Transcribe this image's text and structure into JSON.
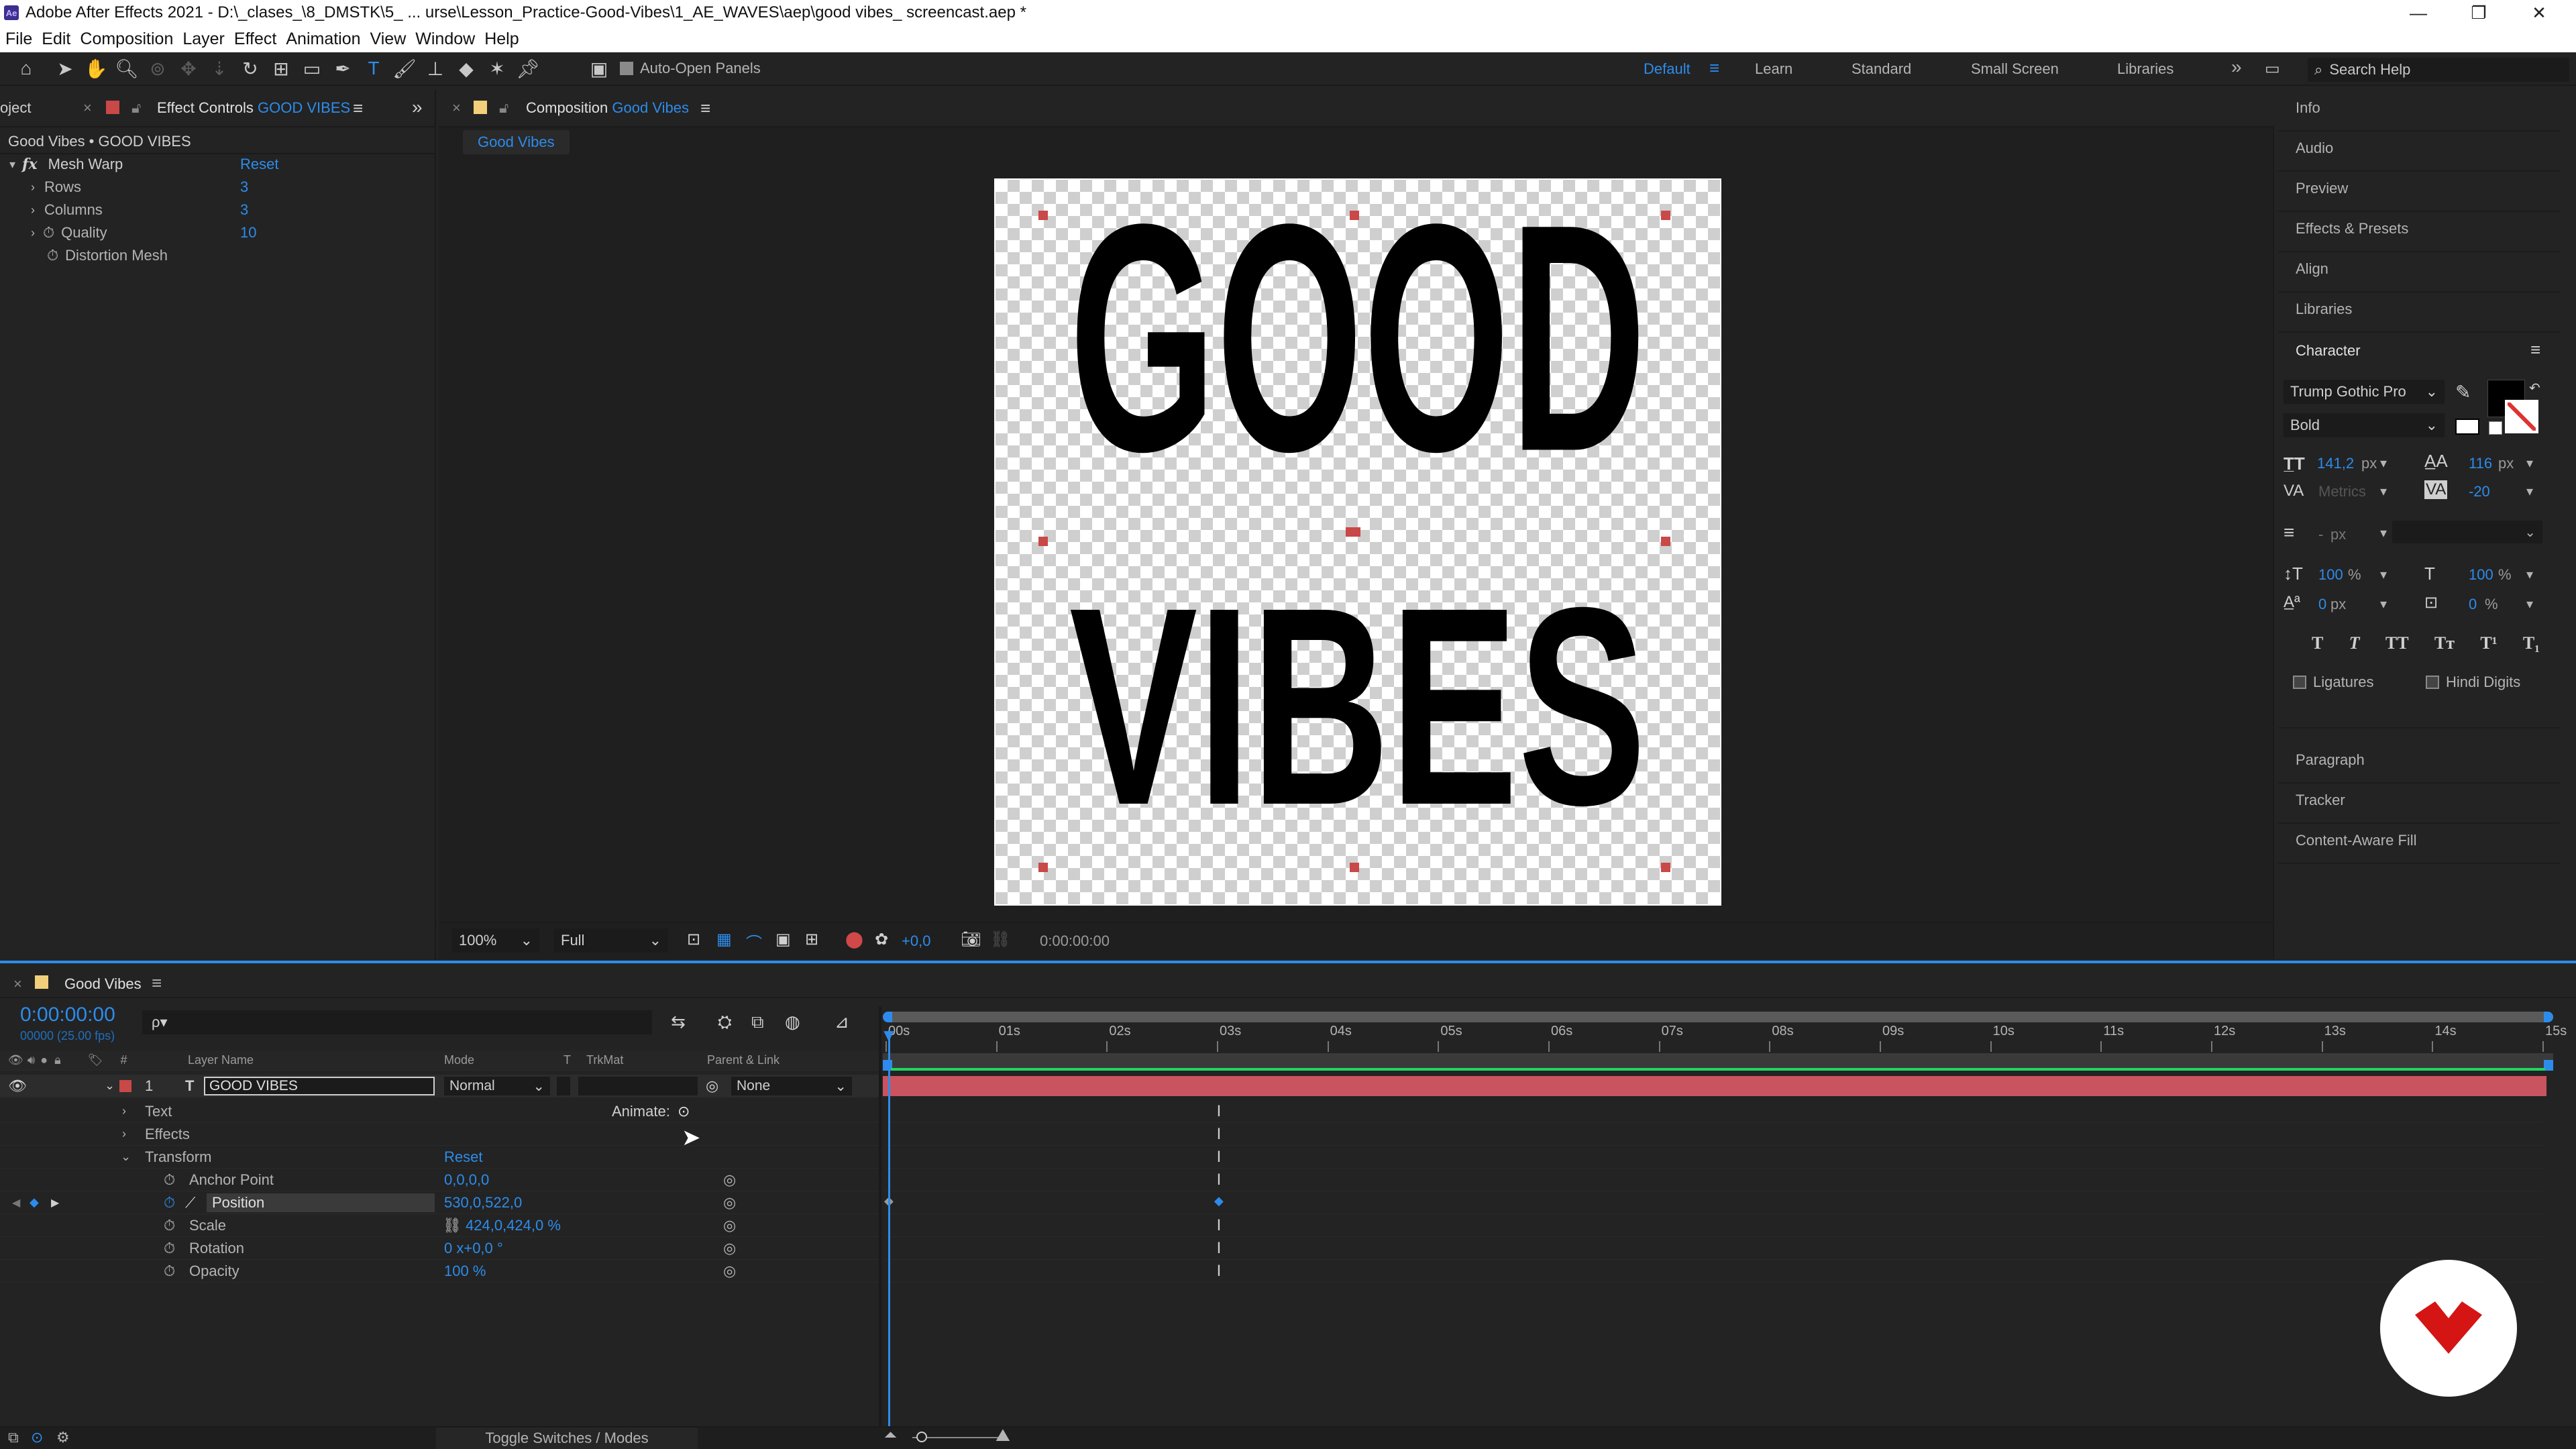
{
  "window": {
    "title": "Adobe After Effects 2021 - D:\\_clases_\\8_DMSTK\\5_ ... urse\\Lesson_Practice-Good-Vibes\\1_AE_WAVES\\aep\\good vibes_ screencast.aep *",
    "app_icon": "Ae",
    "minimize": "—",
    "maximize": "❐",
    "close": "✕"
  },
  "menu": [
    "File",
    "Edit",
    "Composition",
    "Layer",
    "Effect",
    "Animation",
    "View",
    "Window",
    "Help"
  ],
  "toolbar": {
    "auto_open_panels": "Auto-Open Panels",
    "workspaces": [
      "Default",
      "Learn",
      "Standard",
      "Small Screen",
      "Libraries"
    ],
    "active_workspace": "Default",
    "more": "»",
    "search_placeholder": "Search Help"
  },
  "effect_controls": {
    "left_tab": "oject",
    "tab_label": "Effect Controls",
    "tab_layer": "GOOD VIBES",
    "breadcrumb": "Good Vibes • GOOD VIBES",
    "effect_name": "Mesh Warp",
    "reset": "Reset",
    "props": [
      {
        "name": "Rows",
        "value": "3"
      },
      {
        "name": "Columns",
        "value": "3"
      },
      {
        "name": "Quality",
        "value": "10"
      },
      {
        "name": "Distortion Mesh",
        "value": ""
      }
    ]
  },
  "composition": {
    "tab_label": "Composition",
    "tab_name": "Good Vibes",
    "subtab": "Good Vibes",
    "artwork_line1": "GOOD",
    "artwork_line2": "VIBES",
    "zoom": "100%",
    "resolution": "Full",
    "exposure": "+0,0",
    "timecode": "0:00:00:00"
  },
  "side_panels": {
    "items_top": [
      "Info",
      "Audio",
      "Preview",
      "Effects & Presets",
      "Align",
      "Libraries"
    ],
    "character_title": "Character",
    "font_family": "Trump Gothic Pro",
    "font_style": "Bold",
    "font_size": "141,2",
    "font_size_unit": "px",
    "leading": "116",
    "leading_unit": "px",
    "kerning": "Metrics",
    "tracking": "-20",
    "stroke_width": "-",
    "stroke_unit": "px",
    "vert_scale": "100",
    "horiz_scale": "100",
    "pct": "%",
    "baseline": "0",
    "baseline_unit": "px",
    "tsume": "0",
    "styles": [
      "T",
      "T",
      "TT",
      "Tт",
      "T¹",
      "T₁"
    ],
    "ligatures": "Ligatures",
    "hindi_digits": "Hindi Digits",
    "items_bottom": [
      "Paragraph",
      "Tracker",
      "Content-Aware Fill"
    ]
  },
  "timeline": {
    "tab": "Good Vibes",
    "timecode": "0:00:00:00",
    "frame_info": "00000 (25.00 fps)",
    "search_placeholder": "ρ▾",
    "columns": {
      "layer_name": "Layer Name",
      "mode": "Mode",
      "t": "T",
      "trkmat": "TrkMat",
      "parent": "Parent & Link"
    },
    "layer": {
      "index": "1",
      "type": "T",
      "name": "GOOD VIBES",
      "mode": "Normal",
      "parent": "None"
    },
    "animate": "Animate:",
    "groups": [
      "Text",
      "Effects",
      "Transform"
    ],
    "transform_reset": "Reset",
    "transform_props": [
      {
        "name": "Anchor Point",
        "value": "0,0,0,0"
      },
      {
        "name": "Position",
        "value": "530,0,522,0"
      },
      {
        "name": "Scale",
        "value": "424,0,424,0 %"
      },
      {
        "name": "Rotation",
        "value": "0 x+0,0 °"
      },
      {
        "name": "Opacity",
        "value": "100 %"
      }
    ],
    "ruler_ticks": [
      "00s",
      "01s",
      "02s",
      "03s",
      "04s",
      "05s",
      "06s",
      "07s",
      "08s",
      "09s",
      "10s",
      "11s",
      "12s",
      "13s",
      "14s",
      "15s"
    ],
    "toggle": "Toggle Switches / Modes"
  },
  "colors": {
    "accent": "#2d8ceb",
    "layer_bar": "#c9545f",
    "label_red": "#c94848",
    "work_area": "#1ed760"
  }
}
